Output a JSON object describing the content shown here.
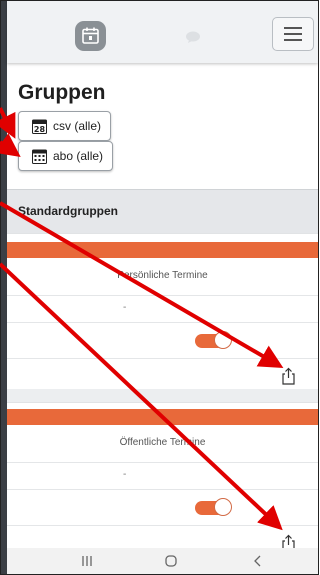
{
  "page": {
    "title": "Gruppen"
  },
  "buttons": {
    "csv": {
      "day": "28",
      "label": "csv (alle)"
    },
    "abo": {
      "label": "abo (alle)"
    }
  },
  "section": {
    "title": "Standardgruppen"
  },
  "groups": [
    {
      "name": "Persönliche Termine",
      "description": "-",
      "enabled": true
    },
    {
      "name": "Öffentliche Termine",
      "description": "-",
      "enabled": true
    }
  ],
  "colors": {
    "accent": "#e8693a",
    "annotation_arrow": "#e00000"
  },
  "icons": {
    "logo": "calendar-icon",
    "chat": "chat-bubble-icon",
    "menu": "hamburger-menu-icon",
    "share": "share-icon",
    "nav_recent": "recent-apps-icon",
    "nav_home": "home-icon",
    "nav_back": "back-icon"
  }
}
